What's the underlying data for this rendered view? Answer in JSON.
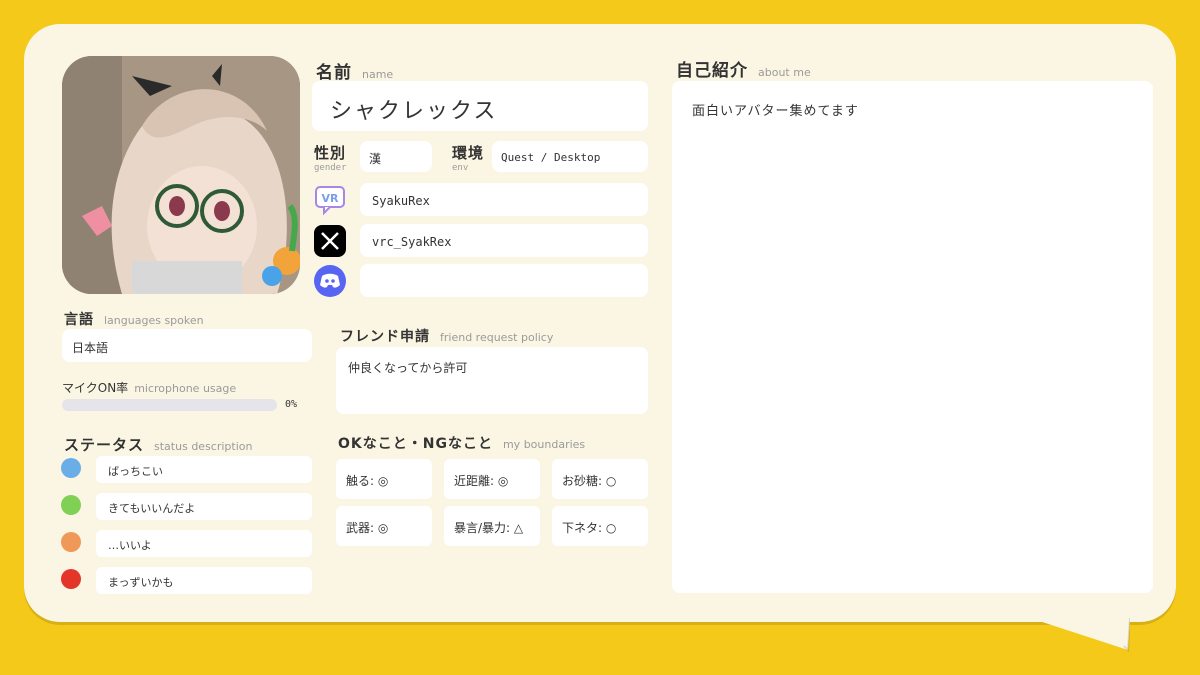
{
  "name": {
    "title": "名前",
    "subtitle": "name",
    "value": "シャクレックス"
  },
  "gender": {
    "title": "性別",
    "subtitle": "gender",
    "value": "漢"
  },
  "env": {
    "title": "環境",
    "subtitle": "env",
    "value": "Quest / Desktop"
  },
  "socials": [
    {
      "icon": "vrchat-icon",
      "value": "SyakuRex"
    },
    {
      "icon": "x-icon",
      "value": "vrc_SyakRex"
    },
    {
      "icon": "discord-icon",
      "value": ""
    }
  ],
  "languages": {
    "title": "言語",
    "subtitle": "languages spoken",
    "value": "日本語"
  },
  "mic": {
    "title": "マイクON率",
    "subtitle": "microphone usage",
    "value": "0%",
    "level": 0
  },
  "status": {
    "title": "ステータス",
    "subtitle": "status description",
    "items": [
      {
        "color": "#6aaee8",
        "label": "ばっちこい"
      },
      {
        "color": "#7fd055",
        "label": "きてもいいんだよ"
      },
      {
        "color": "#f09858",
        "label": "…いいよ"
      },
      {
        "color": "#e4352b",
        "label": "まっずいかも"
      }
    ]
  },
  "friend": {
    "title": "フレンド申請",
    "subtitle": "friend request policy",
    "value": "仲良くなってから許可"
  },
  "boundaries": {
    "title": "OKなこと・NGなこと",
    "subtitle": "my boundaries",
    "items": [
      "触る: ◎",
      "近距離: ◎",
      "お砂糖: ○",
      "武器: ◎",
      "暴言/暴力: △",
      "下ネタ: ○"
    ]
  },
  "about": {
    "title": "自己紹介",
    "subtitle": "about me",
    "value": "面白いアバター集めてます"
  },
  "colors": {
    "background": "#f5c91a",
    "card": "#fbf6e4",
    "field": "#ffffff",
    "discord": "#5865f2"
  }
}
